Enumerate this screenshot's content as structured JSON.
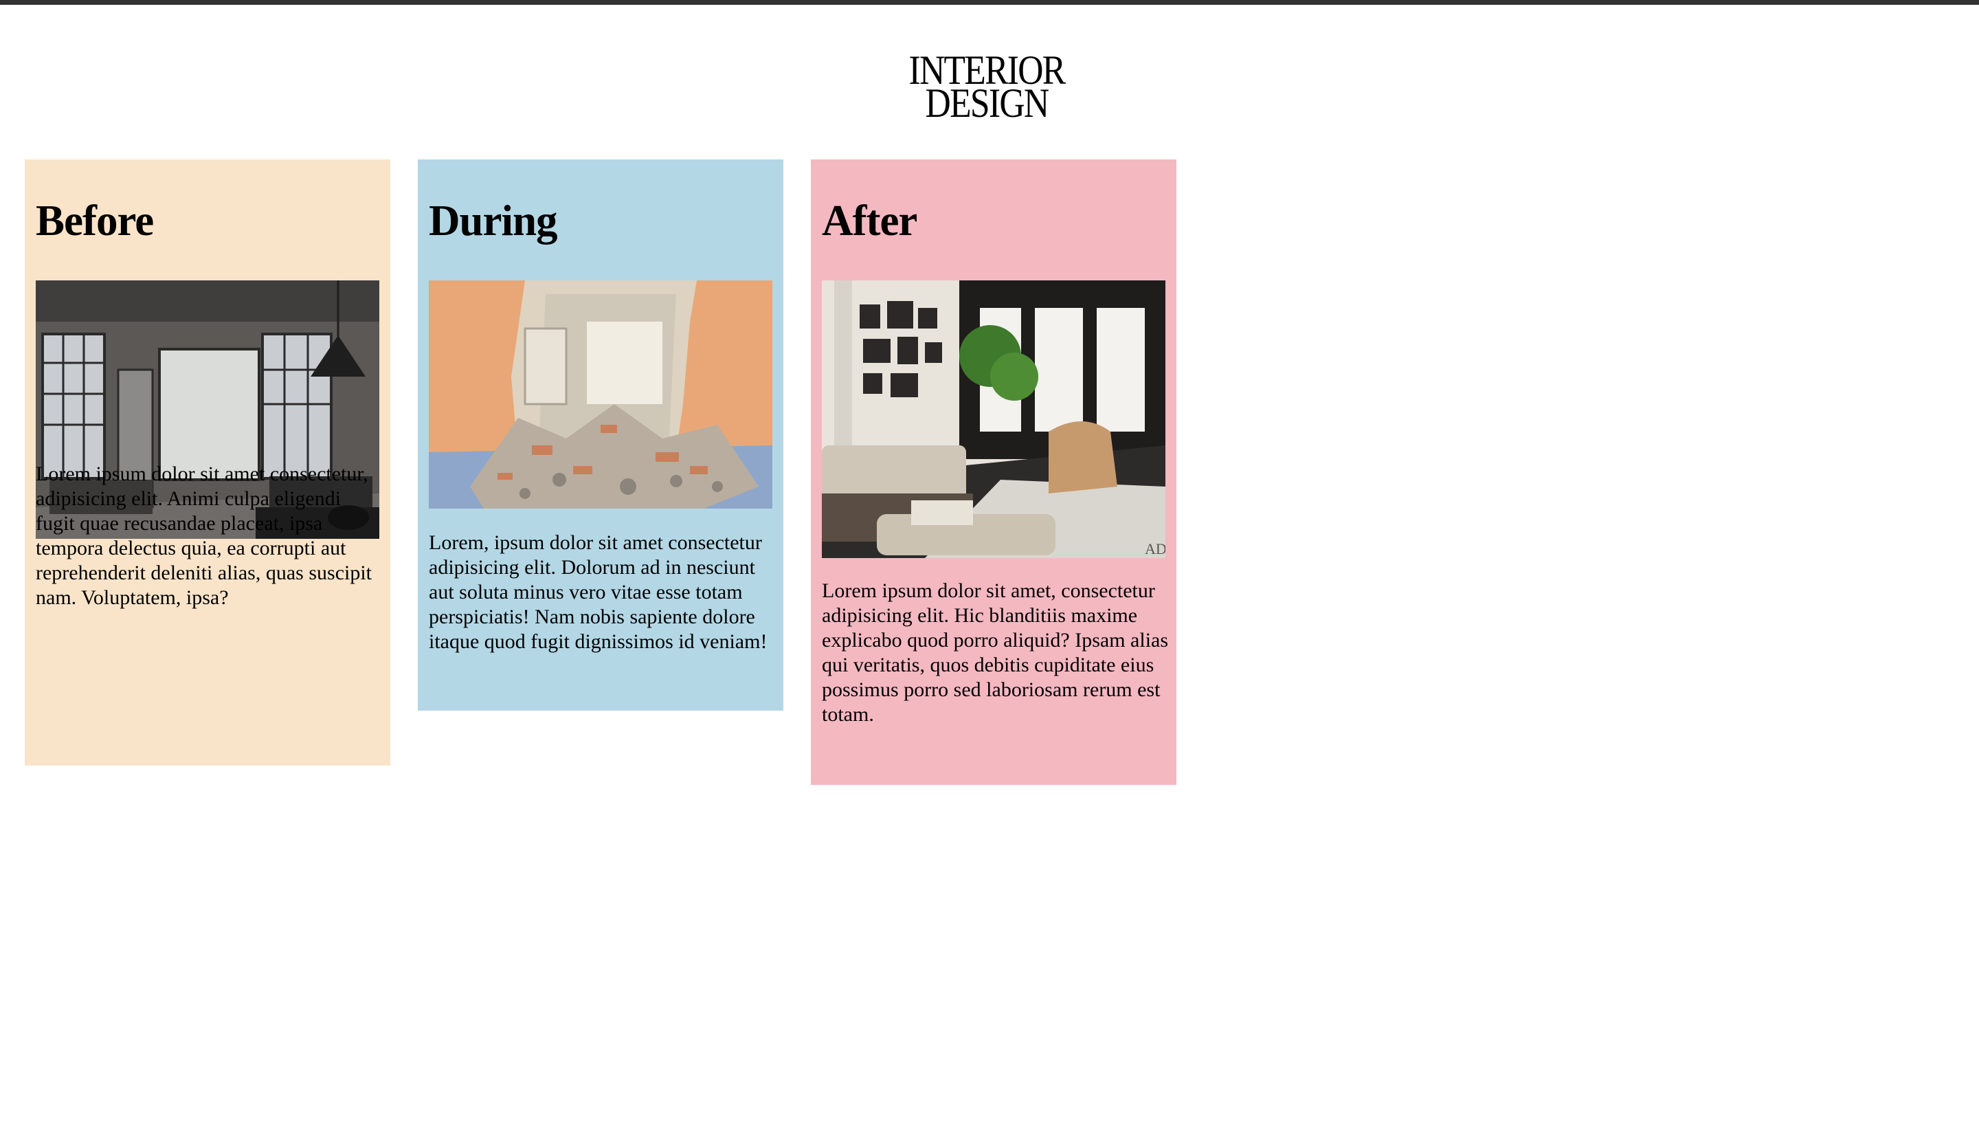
{
  "brand": {
    "line1": "INTERIOR",
    "line2": "DESIGN"
  },
  "colors": {
    "top_bar": "#333333",
    "before_bg": "#f9e4c9",
    "during_bg": "#b4d7e5",
    "after_bg": "#f4b8c1"
  },
  "cards": [
    {
      "title": "Before",
      "image": "empty loft room with steel-frame windows and pendant lamp",
      "text": "Lorem ipsum dolor sit amet consectetur, adipisicing elit. Animi culpa eligendi fugit quae recusandae placeat, ipsa tempora delectus quia, ea corrupti aut reprehenderit deleniti alias, quas suscipit nam. Voluptatem, ipsa?"
    },
    {
      "title": "During",
      "image": "demolished wall with rubble on floor",
      "text": "Lorem, ipsum dolor sit amet consectetur adipisicing elit. Dolorum ad in nesciunt aut soluta minus vero vitae esse totam perspiciatis! Nam nobis sapiente dolore itaque quod fugit dignissimos id veniam!"
    },
    {
      "title": "After",
      "image": "furnished living room with sofa, armchair and gallery wall",
      "watermark": "AD",
      "text": "Lorem ipsum dolor sit amet, consectetur adipisicing elit. Hic blanditiis maxime explicabo quod porro aliquid? Ipsam alias qui veritatis, quos debitis cupiditate eius possimus porro sed laboriosam rerum est totam."
    }
  ]
}
